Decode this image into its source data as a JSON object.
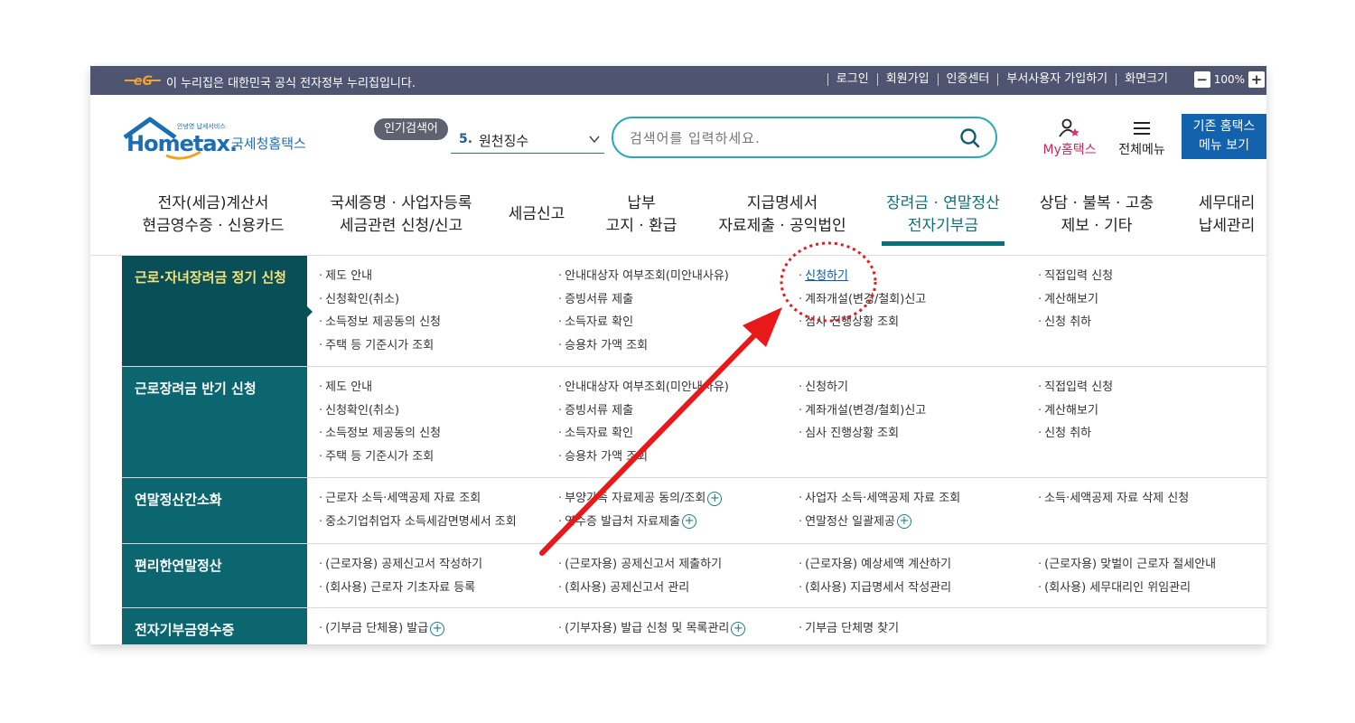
{
  "topbar": {
    "notice": "이 누리집은 대한민국 공식 전자정부 누리집입니다.",
    "links": [
      "로그인",
      "회원가입",
      "인증센터",
      "부서사용자 가입하기",
      "화면크기"
    ],
    "zoom_minus": "−",
    "zoom_value": "100%",
    "zoom_plus": "+"
  },
  "header": {
    "logo_small": "안녕영 납세서비스",
    "logo_brand": "Hometax.",
    "logo_name": "국세청홈택스",
    "popular_label": "인기검색어",
    "popular_num": "5.",
    "popular_term": "원천징수",
    "search_placeholder": "검색어를 입력하세요.",
    "my_label": "My홈택스",
    "allmenu_label": "전체메뉴",
    "oldmenu_line1": "기존 홈택스",
    "oldmenu_line2": "메뉴 보기"
  },
  "gnb": [
    {
      "l1": "전자(세금)계산서",
      "l2": "현금영수증 · 신용카드"
    },
    {
      "l1": "국세증명 · 사업자등록",
      "l2": "세금관련 신청/신고"
    },
    {
      "l1": "세금신고",
      "l2": ""
    },
    {
      "l1": "납부",
      "l2": "고지 · 환급"
    },
    {
      "l1": "지급명세서",
      "l2": "자료제출 · 공익법인"
    },
    {
      "l1": "장려금 · 연말정산",
      "l2": "전자기부금"
    },
    {
      "l1": "상담 · 불복 · 고충",
      "l2": "제보 · 기타"
    },
    {
      "l1": "세무대리",
      "l2": "납세관리"
    }
  ],
  "sections": [
    {
      "title": "근로·자녀장려금 정기 신청",
      "cols": [
        [
          "제도 안내",
          "신청확인(취소)",
          "소득정보 제공동의 신청",
          "주택 등 기준시가 조회"
        ],
        [
          "안내대상자 여부조회(미안내사유)",
          "증빙서류 제출",
          "소득자료 확인",
          "승용차 가액 조회"
        ],
        [
          "신청하기",
          "계좌개설(변경/철회)신고",
          "심사 진행상황 조회"
        ],
        [
          "직접입력 신청",
          "계산해보기",
          "신청 취하"
        ]
      ]
    },
    {
      "title": "근로장려금 반기 신청",
      "cols": [
        [
          "제도 안내",
          "신청확인(취소)",
          "소득정보 제공동의 신청",
          "주택 등 기준시가 조회"
        ],
        [
          "안내대상자 여부조회(미안내사유)",
          "증빙서류 제출",
          "소득자료 확인",
          "승용차 가액 조회"
        ],
        [
          "신청하기",
          "계좌개설(변경/철회)신고",
          "심사 진행상황 조회"
        ],
        [
          "직접입력 신청",
          "계산해보기",
          "신청 취하"
        ]
      ]
    },
    {
      "title": "연말정산간소화",
      "cols": [
        [
          "근로자 소득·세액공제 자료 조회",
          "중소기업취업자 소득세감면명세서 조회"
        ],
        [
          "부양가족 자료제공 동의/조회",
          "영수증 발급처 자료제출"
        ],
        [
          "사업자 소득·세액공제 자료 조회",
          "연말정산 일괄제공"
        ],
        [
          "소득·세액공제 자료 삭제 신청"
        ]
      ]
    },
    {
      "title": "편리한연말정산",
      "cols": [
        [
          "(근로자용) 공제신고서 작성하기",
          "(회사용) 근로자 기초자료 등록"
        ],
        [
          "(근로자용) 공제신고서 제출하기",
          "(회사용) 공제신고서 관리"
        ],
        [
          "(근로자용) 예상세액 계산하기",
          "(회사용) 지급명세서 작성관리"
        ],
        [
          "(근로자용) 맞벌이 근로자 절세안내",
          "(회사용) 세무대리인 위임관리"
        ]
      ]
    },
    {
      "title": "전자기부금영수증",
      "cols": [
        [
          "(기부금 단체용) 발급"
        ],
        [
          "(기부자용) 발급 신청 및 목록관리"
        ],
        [
          "기부금 단체명 찾기"
        ],
        []
      ]
    }
  ],
  "colors": {
    "topbar": "#4f5470",
    "category": "#0b6670",
    "category_selected": "#084f57",
    "active_gnb": "#0b6f7a",
    "search_border": "#29a9b9",
    "annotation": "#e8191b"
  }
}
